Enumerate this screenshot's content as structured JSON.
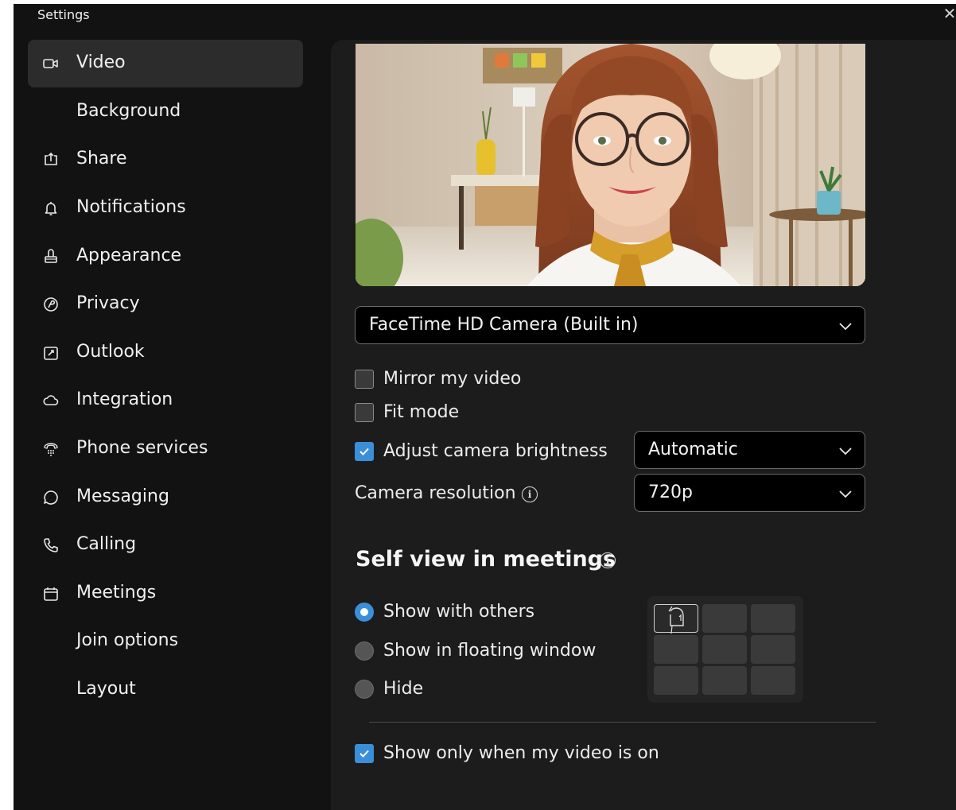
{
  "window": {
    "title": "Settings",
    "close_label": "✕"
  },
  "sidebar": {
    "items": [
      {
        "label": "Video",
        "icon": "video-camera-icon",
        "active": true
      },
      {
        "label": "Background",
        "icon": ""
      },
      {
        "label": "Share",
        "icon": "share-icon"
      },
      {
        "label": "Notifications",
        "icon": "bell-icon"
      },
      {
        "label": "Appearance",
        "icon": "paint-brush-icon"
      },
      {
        "label": "Privacy",
        "icon": "privacy-icon"
      },
      {
        "label": "Outlook",
        "icon": "outlook-icon"
      },
      {
        "label": "Integration",
        "icon": "cloud-icon"
      },
      {
        "label": "Phone services",
        "icon": "phone-services-icon"
      },
      {
        "label": "Messaging",
        "icon": "chat-bubble-icon"
      },
      {
        "label": "Calling",
        "icon": "phone-icon"
      },
      {
        "label": "Meetings",
        "icon": "calendar-icon"
      },
      {
        "label": "Join options",
        "icon": ""
      },
      {
        "label": "Layout",
        "icon": ""
      }
    ]
  },
  "video": {
    "camera_select": "FaceTime HD Camera (Built in)",
    "mirror_label": "Mirror my video",
    "mirror_checked": false,
    "fit_mode_label": "Fit mode",
    "fit_mode_checked": false,
    "brightness_label": "Adjust camera brightness",
    "brightness_checked": true,
    "brightness_select": "Automatic",
    "resolution_label": "Camera resolution",
    "resolution_select": "720p"
  },
  "self_view": {
    "title": "Self view in meetings",
    "options": [
      {
        "label": "Show with others",
        "selected": true
      },
      {
        "label": "Show in floating window",
        "selected": false
      },
      {
        "label": "Hide",
        "selected": false
      }
    ],
    "only_when_video_on_label": "Show only when my video is on",
    "only_when_video_on_checked": true
  },
  "colors": {
    "accent": "#3b8fd9",
    "window_bg": "#121212",
    "panel_bg": "#1c1c1c"
  }
}
